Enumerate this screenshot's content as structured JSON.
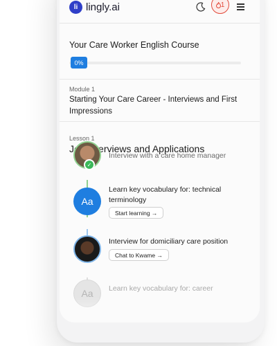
{
  "app": {
    "logo_letters": "li",
    "brand": "lingly.ai",
    "streak_count": "1"
  },
  "icons": {
    "logo": "logo-icon",
    "theme": "moon-icon",
    "streak": "flame-icon",
    "menu": "hamburger-icon",
    "completed": "check-icon"
  },
  "course": {
    "title": "Your Care Worker English Course",
    "progress_label": "0%",
    "progress_fraction": 0
  },
  "module": {
    "label": "Module 1",
    "title": "Starting Your Care Career - Interviews and First Impressions"
  },
  "lesson": {
    "label": "Lesson 1",
    "title": "Job Interviews and Applications"
  },
  "items": [
    {
      "text": "Interview with a care home manager",
      "status": "completed"
    },
    {
      "icon_text": "Aa",
      "text": "Learn key vocabulary for: technical terminology",
      "action": "Start learning →"
    },
    {
      "text": "Interview for domiciliary care position",
      "action": "Chat to Kwame →"
    },
    {
      "icon_text": "Aa",
      "text": "Learn key vocabulary for: career",
      "status": "locked"
    }
  ],
  "colors": {
    "accent": "#1f7ee0",
    "streak": "#e24a3b",
    "success": "#3cb85a"
  }
}
